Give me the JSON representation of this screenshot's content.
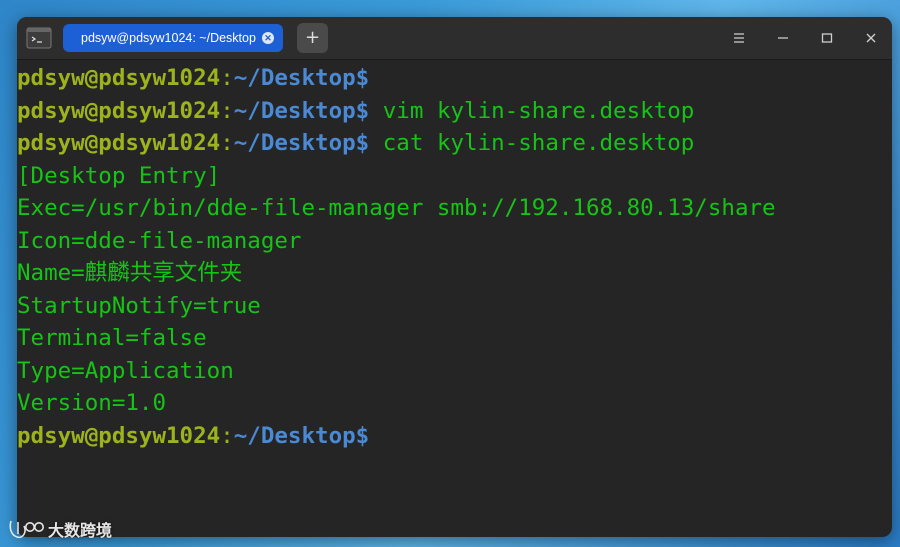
{
  "tab": {
    "title": "pdsyw@pdsyw1024: ~/Desktop",
    "close_icon": "close-icon"
  },
  "new_tab_label": "+",
  "controls": {
    "menu": "menu-icon",
    "minimize": "minimize-icon",
    "maximize": "maximize-icon",
    "close": "close-icon"
  },
  "terminal": {
    "user": "pdsyw@pdsyw1024",
    "colon": ":",
    "path": "~/Desktop$",
    "lines": [
      {
        "type": "prompt",
        "cmd": ""
      },
      {
        "type": "prompt",
        "cmd": " vim kylin-share.desktop"
      },
      {
        "type": "prompt",
        "cmd": " cat kylin-share.desktop"
      },
      {
        "type": "output",
        "text": "[Desktop Entry]"
      },
      {
        "type": "output",
        "text": "Exec=/usr/bin/dde-file-manager smb://192.168.80.13/share"
      },
      {
        "type": "output",
        "text": "Icon=dde-file-manager"
      },
      {
        "type": "output",
        "text": "Name=麒麟共享文件夹"
      },
      {
        "type": "output",
        "text": "StartupNotify=true"
      },
      {
        "type": "output",
        "text": "Terminal=false"
      },
      {
        "type": "output",
        "text": "Type=Application"
      },
      {
        "type": "output",
        "text": "Version=1.0"
      },
      {
        "type": "prompt",
        "cmd": ""
      }
    ]
  },
  "watermark": {
    "text": "大数跨境"
  }
}
